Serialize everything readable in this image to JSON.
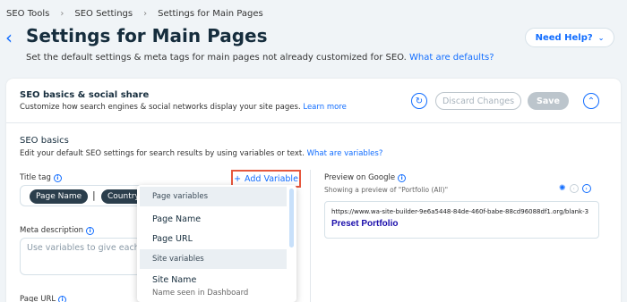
{
  "breadcrumbs": [
    "SEO Tools",
    "SEO Settings",
    "Settings for Main Pages"
  ],
  "page": {
    "title": "Settings for Main Pages",
    "subtitle": "Set the default settings & meta tags for main pages not already customized for SEO.",
    "subtitle_link": "What are defaults?",
    "help_button": "Need Help?"
  },
  "card": {
    "title": "SEO basics & social share",
    "subtitle": "Customize how search engines & social networks display your site pages.",
    "subtitle_link": "Learn more",
    "discard_label": "Discard Changes",
    "save_label": "Save"
  },
  "seo_basics": {
    "title": "SEO basics",
    "subtitle": "Edit your default SEO settings for search results by using variables or text.",
    "subtitle_link": "What are variables?",
    "title_tag_label": "Title tag",
    "chips": [
      "Page Name",
      "Country"
    ],
    "separator": "|",
    "add_variable_label": "Add Variable",
    "meta_description_label": "Meta description",
    "meta_placeholder": "Use variables to give each",
    "page_url_label": "Page URL"
  },
  "preview": {
    "title": "Preview on Google",
    "subtitle": "Showing a preview of \"Portfolio (All)\"",
    "url": "https://www.wa-site-builder-9e6a5448-84de-460f-babe-88cd96088df1.org/blank-3",
    "result_title": "Preset Portfolio"
  },
  "dropdown": {
    "groups": [
      {
        "label": "Page variables",
        "items": [
          "Page Name",
          "Page URL"
        ]
      },
      {
        "label": "Site variables",
        "items": [
          "Site Name"
        ]
      }
    ],
    "site_name_note": "Name seen in Dashboard"
  },
  "colors": {
    "accent": "#116dff",
    "highlight": "#e6573d",
    "chip": "#2b3e4c"
  }
}
